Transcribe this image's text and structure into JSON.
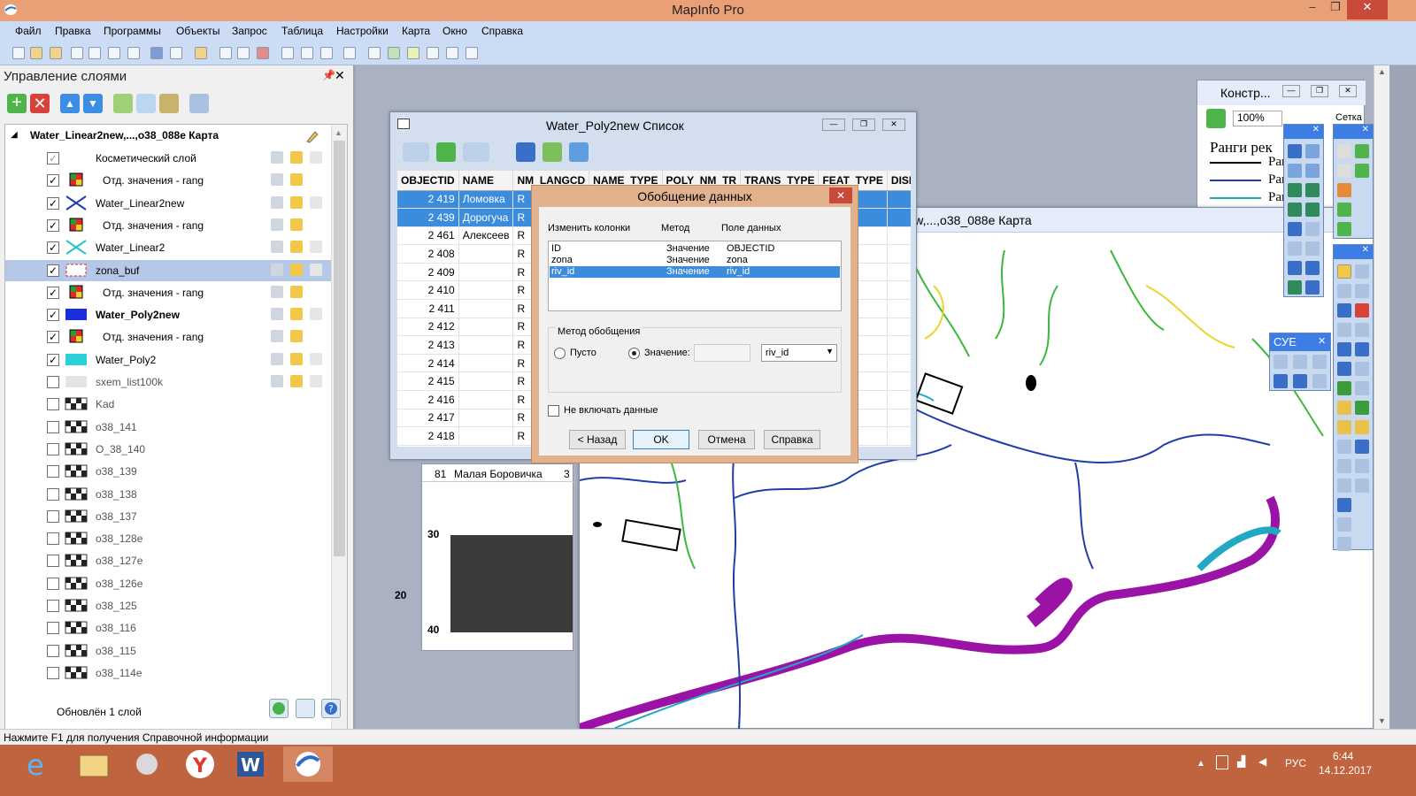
{
  "app": {
    "title": "MapInfo Pro"
  },
  "menu": [
    "Файл",
    "Правка",
    "Программы",
    "Объекты",
    "Запрос",
    "Таблица",
    "Настройки",
    "Карта",
    "Окно",
    "Справка"
  ],
  "layer_panel": {
    "title": "Управление слоями",
    "map_name": "Water_Linear2new,...,o38_088e Карта",
    "status": "Обновлён 1 слой",
    "layers": [
      {
        "label": "Косметический слой",
        "checked": true,
        "bold": false,
        "indent": false,
        "swatch": "cosmetic"
      },
      {
        "label": "Отд. значения - rang",
        "checked": true,
        "bold": false,
        "indent": true,
        "swatch": "theme"
      },
      {
        "label": "Water_Linear2new",
        "checked": true,
        "bold": false,
        "indent": false,
        "swatch": "line-blue"
      },
      {
        "label": "Отд. значения - rang",
        "checked": true,
        "bold": false,
        "indent": true,
        "swatch": "theme"
      },
      {
        "label": "Water_Linear2",
        "checked": true,
        "bold": false,
        "indent": false,
        "swatch": "line-cyan"
      },
      {
        "label": "zona_buf",
        "checked": true,
        "bold": false,
        "indent": false,
        "swatch": "rect-red",
        "selected": true
      },
      {
        "label": "Отд. значения - rang",
        "checked": true,
        "bold": false,
        "indent": true,
        "swatch": "theme"
      },
      {
        "label": "Water_Poly2new",
        "checked": true,
        "bold": true,
        "indent": false,
        "swatch": "poly-blue"
      },
      {
        "label": "Отд. значения - rang",
        "checked": true,
        "bold": false,
        "indent": true,
        "swatch": "theme"
      },
      {
        "label": "Water_Poly2",
        "checked": true,
        "bold": false,
        "indent": false,
        "swatch": "poly-cyan"
      },
      {
        "label": "sxem_list100k",
        "checked": false,
        "bold": false,
        "indent": false,
        "swatch": "grey"
      },
      {
        "label": "Kad",
        "checked": false,
        "bold": false,
        "indent": false,
        "swatch": "raster"
      },
      {
        "label": "o38_141",
        "checked": false,
        "bold": false,
        "indent": false,
        "swatch": "raster"
      },
      {
        "label": "O_38_140",
        "checked": false,
        "bold": false,
        "indent": false,
        "swatch": "raster"
      },
      {
        "label": "o38_139",
        "checked": false,
        "bold": false,
        "indent": false,
        "swatch": "raster"
      },
      {
        "label": "o38_138",
        "checked": false,
        "bold": false,
        "indent": false,
        "swatch": "raster"
      },
      {
        "label": "o38_137",
        "checked": false,
        "bold": false,
        "indent": false,
        "swatch": "raster"
      },
      {
        "label": "o38_128e",
        "checked": false,
        "bold": false,
        "indent": false,
        "swatch": "raster"
      },
      {
        "label": "o38_127e",
        "checked": false,
        "bold": false,
        "indent": false,
        "swatch": "raster"
      },
      {
        "label": "o38_126e",
        "checked": false,
        "bold": false,
        "indent": false,
        "swatch": "raster"
      },
      {
        "label": "o38_125",
        "checked": false,
        "bold": false,
        "indent": false,
        "swatch": "raster"
      },
      {
        "label": "o38_116",
        "checked": false,
        "bold": false,
        "indent": false,
        "swatch": "raster"
      },
      {
        "label": "o38_115",
        "checked": false,
        "bold": false,
        "indent": false,
        "swatch": "raster"
      },
      {
        "label": "o38_114e",
        "checked": false,
        "bold": false,
        "indent": false,
        "swatch": "raster"
      }
    ]
  },
  "list_window": {
    "title": "Water_Poly2new Список",
    "columns": [
      "OBJECTID",
      "NAME",
      "NM_LANGCD",
      "NAME_TYPE",
      "POLY_NM_TR",
      "TRANS_TYPE",
      "FEAT_TYPE",
      "DISF"
    ],
    "rows": [
      {
        "id": "2 419",
        "name": "Ломовка",
        "c3": "R",
        "hl": true
      },
      {
        "id": "2 439",
        "name": "Дорогуча",
        "c3": "R",
        "hl": true
      },
      {
        "id": "2 461",
        "name": "Алексеев",
        "c3": "R",
        "hl": false
      },
      {
        "id": "2 408",
        "name": "",
        "c3": "R",
        "hl": false
      },
      {
        "id": "2 409",
        "name": "",
        "c3": "R",
        "hl": false
      },
      {
        "id": "2 410",
        "name": "",
        "c3": "R",
        "hl": false
      },
      {
        "id": "2 411",
        "name": "",
        "c3": "R",
        "hl": false
      },
      {
        "id": "2 412",
        "name": "",
        "c3": "R",
        "hl": false
      },
      {
        "id": "2 413",
        "name": "",
        "c3": "R",
        "hl": false
      },
      {
        "id": "2 414",
        "name": "",
        "c3": "R",
        "hl": false
      },
      {
        "id": "2 415",
        "name": "",
        "c3": "R",
        "hl": false
      },
      {
        "id": "2 416",
        "name": "",
        "c3": "R",
        "hl": false
      },
      {
        "id": "2 417",
        "name": "",
        "c3": "R",
        "hl": false
      },
      {
        "id": "2 418",
        "name": "",
        "c3": "R",
        "hl": false
      }
    ]
  },
  "under_list": {
    "num": "81",
    "name": "Малая Боровичка",
    "val": "3",
    "tick30": "30",
    "tick20": "20",
    "tick40": "40"
  },
  "map_window": {
    "title": "Linear2new,...,o38_088e Карта"
  },
  "dialog": {
    "title": "Обобщение данных",
    "headers": {
      "col": "Изменить колонки",
      "method": "Метод",
      "field": "Поле данных"
    },
    "rows": [
      {
        "col": "ID",
        "method": "Значение",
        "field": "OBJECTID",
        "sel": false
      },
      {
        "col": "zona",
        "method": "Значение",
        "field": "zona",
        "sel": false
      },
      {
        "col": "riv_id",
        "method": "Значение",
        "field": "riv_id",
        "sel": true
      }
    ],
    "group_label": "Метод обобщения",
    "radio_empty": "Пусто",
    "radio_value": "Значение:",
    "select_value": "riv_id",
    "exclude_label": "Не включать данные",
    "btn_back": "< Назад",
    "btn_ok": "OK",
    "btn_cancel": "Отмена",
    "btn_help": "Справка"
  },
  "konstr": {
    "title": "Констр...",
    "zoom": "100%",
    "grid": "Сетка",
    "heading": "Ранги рек",
    "items": [
      "Ранг",
      "Ранг",
      "Ранг"
    ]
  },
  "sue": {
    "title": "СУЕ"
  },
  "statusbar": {
    "text": "Нажмите F1 для получения Справочной информации"
  },
  "taskbar": {
    "lang": "РУС",
    "time": "6:44",
    "date": "14.12.2017"
  }
}
